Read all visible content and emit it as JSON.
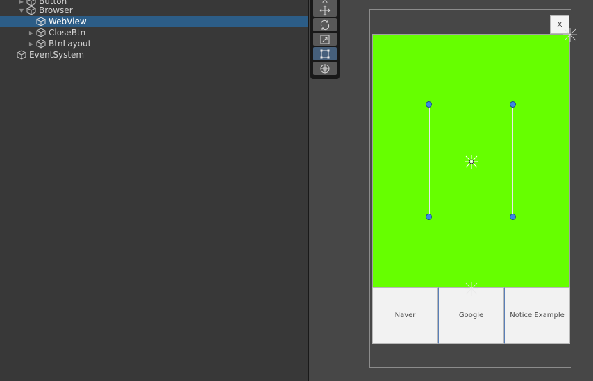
{
  "hierarchy": {
    "items": [
      {
        "label": "Button",
        "expanded": false,
        "has_children": true
      },
      {
        "label": "Browser",
        "expanded": true,
        "has_children": true
      },
      {
        "label": "WebView",
        "expanded": false,
        "has_children": false,
        "selected": true
      },
      {
        "label": "CloseBtn",
        "expanded": false,
        "has_children": true
      },
      {
        "label": "BtnLayout",
        "expanded": false,
        "has_children": true
      },
      {
        "label": "EventSystem",
        "expanded": false,
        "has_children": false
      }
    ]
  },
  "scene": {
    "tools": [
      {
        "name": "view-tool",
        "icon": "hand-icon"
      },
      {
        "name": "move-tool",
        "icon": "move-arrows-icon"
      },
      {
        "name": "rotate-tool",
        "icon": "rotate-icon"
      },
      {
        "name": "scale-tool",
        "icon": "scale-icon"
      },
      {
        "name": "rect-tool",
        "icon": "rect-transform-icon",
        "active": true
      },
      {
        "name": "transform-tool",
        "icon": "transform-icon"
      }
    ],
    "close_button_label": "X",
    "buttons": [
      "Naver",
      "Google",
      "Notice Example"
    ],
    "colors": {
      "webview_fill": "#66ff00",
      "selection_highlight": "#2c5d87",
      "active_tool": "#46607c",
      "handle": "#3a86e6"
    }
  }
}
